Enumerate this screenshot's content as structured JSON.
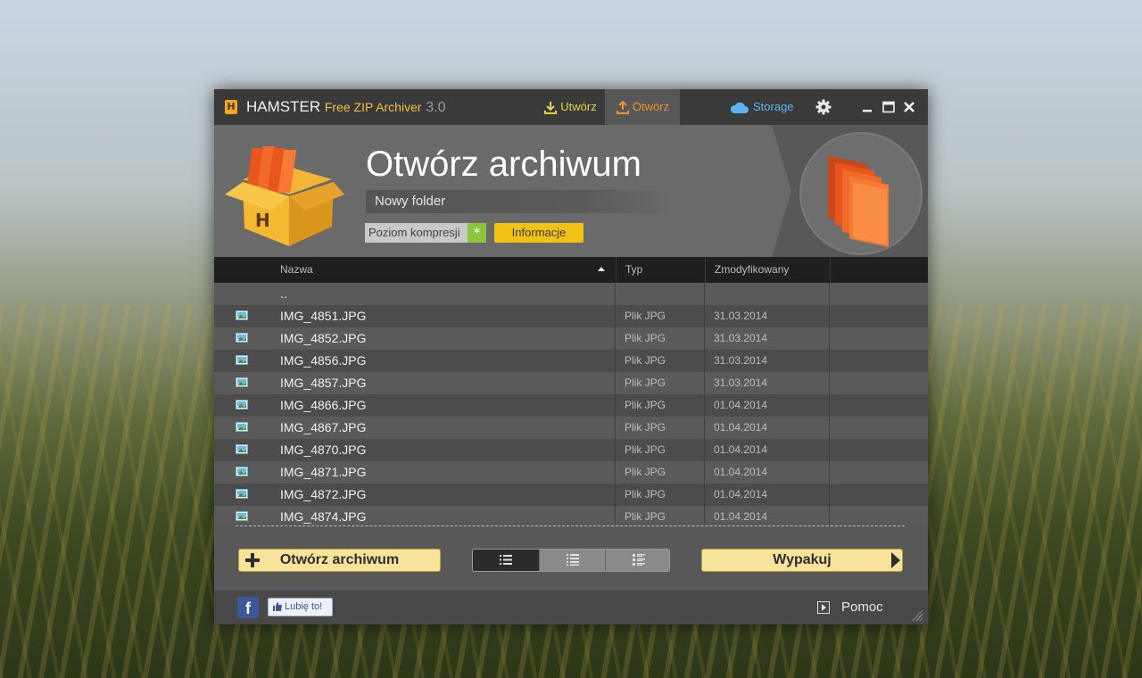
{
  "app": {
    "logo_letter": "H",
    "name": "HAMSTER",
    "product": "Free ZIP Archiver",
    "version": "3.0"
  },
  "tabs": [
    {
      "label": "Utwórz",
      "active": false
    },
    {
      "label": "Otwórz",
      "active": true
    }
  ],
  "storage_label": "Storage",
  "header": {
    "title": "Otwórz archiwum",
    "folder_name": "Nowy folder",
    "compress_label": "Poziom kompresji",
    "compress_value": "*",
    "info_button": "Informacje"
  },
  "table": {
    "columns": [
      "Nazwa",
      "Typ",
      "Zmodyfikowany"
    ],
    "sort": {
      "column": "Nazwa",
      "direction": "ascending"
    },
    "parent_row": "..",
    "rows": [
      {
        "name": "IMG_4851.JPG",
        "type": "Plik JPG",
        "date": "31.03.2014"
      },
      {
        "name": "IMG_4852.JPG",
        "type": "Plik JPG",
        "date": "31.03.2014"
      },
      {
        "name": "IMG_4856.JPG",
        "type": "Plik JPG",
        "date": "31.03.2014"
      },
      {
        "name": "IMG_4857.JPG",
        "type": "Plik JPG",
        "date": "31.03.2014"
      },
      {
        "name": "IMG_4866.JPG",
        "type": "Plik JPG",
        "date": "01.04.2014"
      },
      {
        "name": "IMG_4867.JPG",
        "type": "Plik JPG",
        "date": "01.04.2014"
      },
      {
        "name": "IMG_4870.JPG",
        "type": "Plik JPG",
        "date": "01.04.2014"
      },
      {
        "name": "IMG_4871.JPG",
        "type": "Plik JPG",
        "date": "01.04.2014"
      },
      {
        "name": "IMG_4872.JPG",
        "type": "Plik JPG",
        "date": "01.04.2014"
      },
      {
        "name": "IMG_4874.JPG",
        "type": "Plik JPG",
        "date": "01.04.2014"
      }
    ]
  },
  "actions": {
    "open_archive": "Otwórz archiwum",
    "extract": "Wypakuj",
    "view_modes": [
      "list-view",
      "details-view",
      "tiles-view"
    ],
    "active_view": 0
  },
  "footer": {
    "facebook_letter": "f",
    "like_label": "Lubię to!",
    "help_label": "Pomoc"
  },
  "colors": {
    "accent_orange": "#f2932a",
    "accent_yellow": "#f2c314",
    "storage_blue": "#5ab4f0",
    "compress_green": "#8cc63f",
    "button_fill": "#f7e39a"
  }
}
